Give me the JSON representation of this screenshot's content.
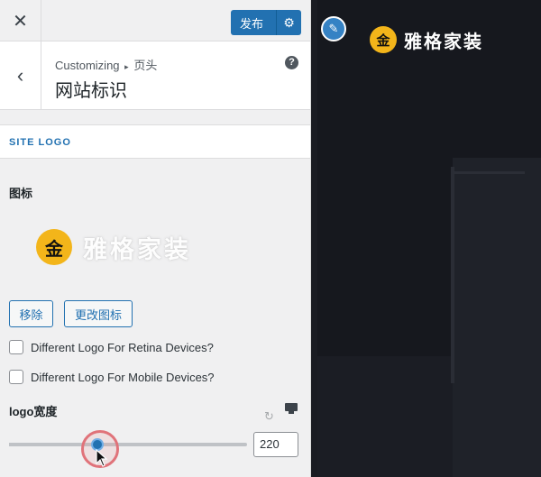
{
  "topbar": {
    "close_glyph": "✕",
    "publish_label": "发布",
    "gear_glyph": "⚙"
  },
  "header": {
    "back_glyph": "‹",
    "crumb_parent": "Customizing",
    "crumb_arrow": "▸",
    "crumb_child": "页头",
    "title": "网站标识",
    "help_glyph": "?"
  },
  "section": {
    "heading": "SITE LOGO"
  },
  "logo_field": {
    "label": "图标",
    "logo_coin_char": "金",
    "logo_text": "雅格家装",
    "remove_label": "移除",
    "change_label": "更改图标"
  },
  "checkboxes": [
    {
      "label": "Different Logo For Retina Devices?",
      "checked": false
    },
    {
      "label": "Different Logo For Mobile Devices?",
      "checked": false
    }
  ],
  "width_field": {
    "label": "logo宽度",
    "reset_glyph": "↻",
    "value": "220",
    "slider_fraction": 0.37
  },
  "preview": {
    "edit_glyph": "✎",
    "logo_coin_char": "金",
    "logo_text": "雅格家装"
  },
  "colors": {
    "accent": "#2271b1",
    "logo_gold": "#f3b51a",
    "preview_bg": "#16181e"
  },
  "icons": [
    "close-icon",
    "gear-icon",
    "back-chevron-icon",
    "help-icon",
    "reset-icon",
    "desktop-device-icon",
    "pencil-icon",
    "mouse-cursor-icon"
  ]
}
